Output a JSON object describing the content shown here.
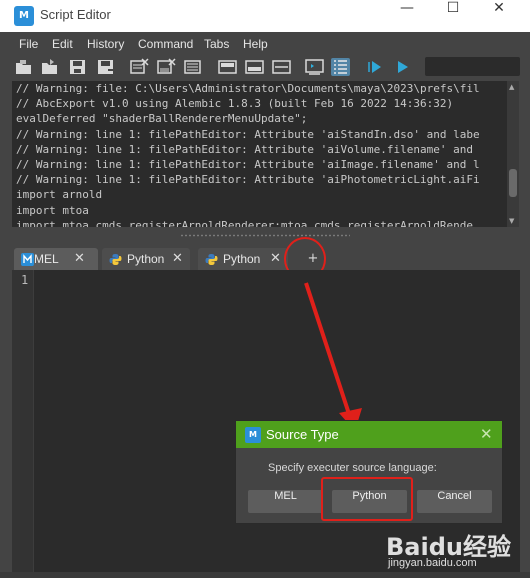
{
  "window": {
    "app_icon_text": "M",
    "title": "Script Editor",
    "controls": {
      "minimize": "—",
      "maximize": "☐",
      "close": "✕"
    }
  },
  "menubar": [
    "File",
    "Edit",
    "History",
    "Command",
    "Tabs",
    "Help"
  ],
  "toolbar": {
    "icons": [
      "open-script-icon",
      "source-script-icon",
      "save-script-icon",
      "save-script-to-shelf-icon",
      "clear-history-icon",
      "clear-input-icon",
      "clear-all-icon",
      "show-history-icon",
      "show-input-icon",
      "show-both-icon",
      "echo-all-commands-icon",
      "show-line-numbers-icon",
      "execute-all-icon",
      "execute-icon"
    ],
    "active_icon": "show-line-numbers-icon"
  },
  "output_lines": [
    "// Warning: file: C:\\Users\\Administrator\\Documents\\maya\\2023\\prefs\\fil",
    "// AbcExport v1.0 using Alembic 1.8.3 (built Feb 16 2022 14:36:32)",
    "evalDeferred \"shaderBallRendererMenuUpdate\";",
    "// Warning: line 1: filePathEditor: Attribute 'aiStandIn.dso' and labe",
    "// Warning: line 1: filePathEditor: Attribute 'aiVolume.filename' and",
    "// Warning: line 1: filePathEditor: Attribute 'aiImage.filename' and l",
    "// Warning: line 1: filePathEditor: Attribute 'aiPhotometricLight.aiFi",
    "import arnold",
    "import mtoa",
    "import mtoa.cmds.registerArnoldRenderer;mtoa.cmds.registerArnoldRende"
  ],
  "tabs": [
    {
      "label": "MEL",
      "icon": "maya-icon",
      "close": "✕"
    },
    {
      "label": "Python",
      "icon": "python-icon",
      "close": "✕"
    },
    {
      "label": "Python",
      "icon": "python-icon",
      "close": "✕"
    }
  ],
  "add_tab_label": "+",
  "editor": {
    "line_number": "1"
  },
  "dialog": {
    "icon_text": "M",
    "title": "Source Type",
    "close": "✕",
    "prompt": "Specify executer source language:",
    "buttons": {
      "mel": "MEL",
      "python": "Python",
      "cancel": "Cancel"
    },
    "title_color": "#4fa01c"
  },
  "annotations": {
    "highlight_color": "#e0201a"
  },
  "watermark": {
    "logo": "Baidu经验",
    "url": "jingyan.baidu.com"
  }
}
